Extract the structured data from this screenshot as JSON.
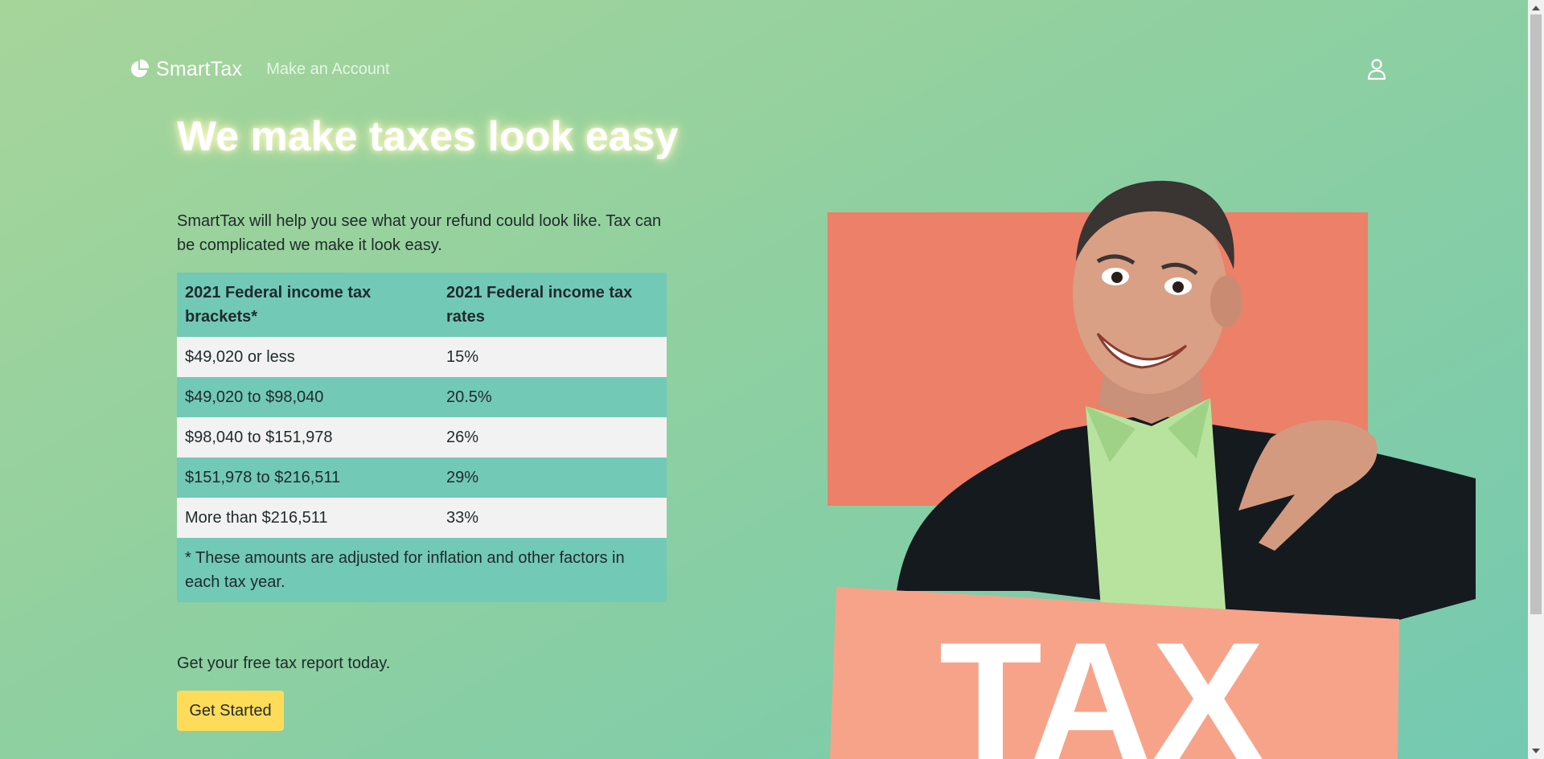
{
  "nav": {
    "brand": "SmartTax",
    "brand_icon": "pie-chart-icon",
    "links": [
      "Make an Account"
    ],
    "user_icon": "user-icon"
  },
  "hero": {
    "title": "We make taxes look easy",
    "intro": "SmartTax will help you see what your refund could look like. Tax can be complicated we make it look easy.",
    "art_sign_text": "TAX"
  },
  "table": {
    "headers": [
      "2021 Federal income tax brackets*",
      "2021 Federal income tax rates"
    ],
    "rows": [
      [
        "$49,020 or less",
        "15%"
      ],
      [
        "$49,020 to $98,040",
        "20.5%"
      ],
      [
        "$98,040 to $151,978",
        "26%"
      ],
      [
        "$151,978 to $216,511",
        "29%"
      ],
      [
        "More than $216,511",
        "33%"
      ]
    ],
    "footnote": "* These amounts are adjusted for inflation and other factors in each tax year."
  },
  "cta": {
    "text": "Get your free tax report today.",
    "button": "Get Started"
  },
  "colors": {
    "accent_button": "#fedc5a",
    "table_teal": "#72c9b6",
    "table_light": "#f2f2f2",
    "art_backdrop": "#ec8068",
    "art_sign": "#f7a38a"
  }
}
